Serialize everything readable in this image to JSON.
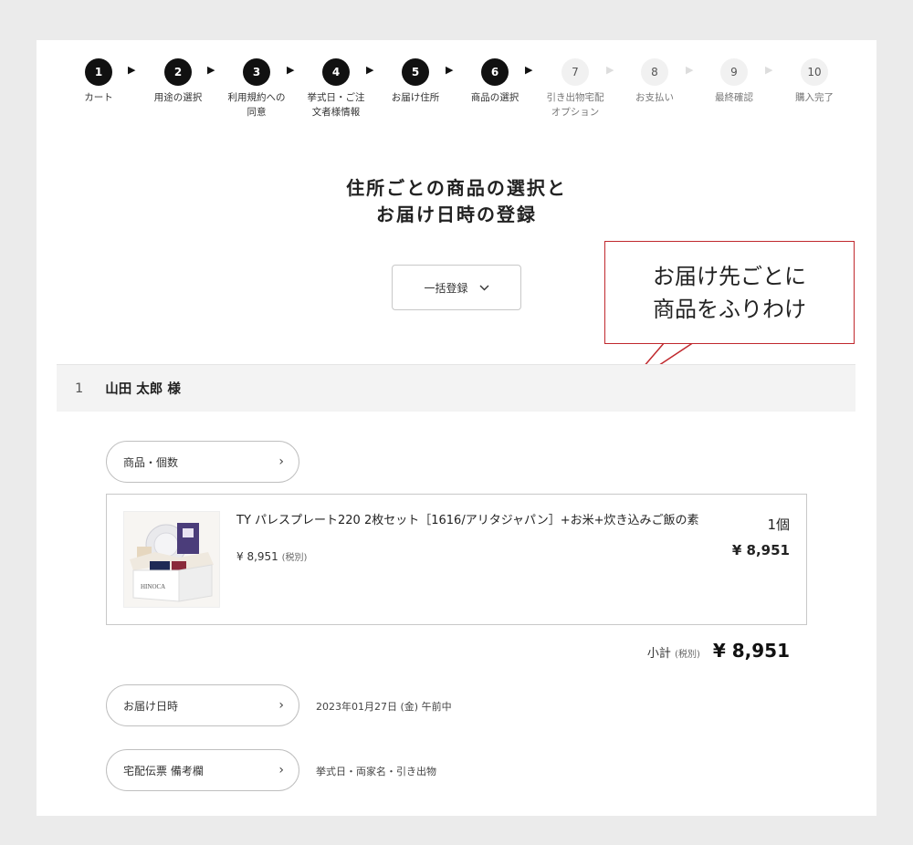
{
  "steps": [
    {
      "num": "1",
      "label": "カート"
    },
    {
      "num": "2",
      "label": "用途の選択"
    },
    {
      "num": "3",
      "label": "利用規約への\n同意"
    },
    {
      "num": "4",
      "label": "挙式日・ご注\n文者様情報"
    },
    {
      "num": "5",
      "label": "お届け住所"
    },
    {
      "num": "6",
      "label": "商品の選択"
    },
    {
      "num": "7",
      "label": "引き出物宅配\nオプション"
    },
    {
      "num": "8",
      "label": "お支払い"
    },
    {
      "num": "9",
      "label": "最終確認"
    },
    {
      "num": "10",
      "label": "購入完了"
    }
  ],
  "page": {
    "title_line1": "住所ごとの商品の選択と",
    "title_line2": "お届け日時の登録",
    "bulk_button": "一括登録"
  },
  "callout": {
    "line1": "お届け先ごとに",
    "line2": "商品をふりわけ"
  },
  "recipient": {
    "number": "1",
    "name": "山田 太郎 様"
  },
  "items_pill": "商品・個数",
  "product": {
    "name": "TY パレスプレート220 2枚セット［1616/アリタジャパン］+お米+炊き込みご飯の素",
    "price": "¥ 8,951",
    "price_tax": "(税別)",
    "qty": "1個",
    "total": "¥ 8,951",
    "image_text": "HINOCA"
  },
  "subtotal": {
    "label": "小計",
    "tax": "(税別)",
    "value": "¥ 8,951"
  },
  "delivery": {
    "pill": "お届け日時",
    "value": "2023年01月27日 (金) 午前中"
  },
  "note": {
    "pill": "宅配伝票 備考欄",
    "value": "挙式日・両家名・引き出物"
  },
  "colors": {
    "callout_border": "#c0282d",
    "step_done": "#111111",
    "step_todo": "#f1f1f1"
  }
}
